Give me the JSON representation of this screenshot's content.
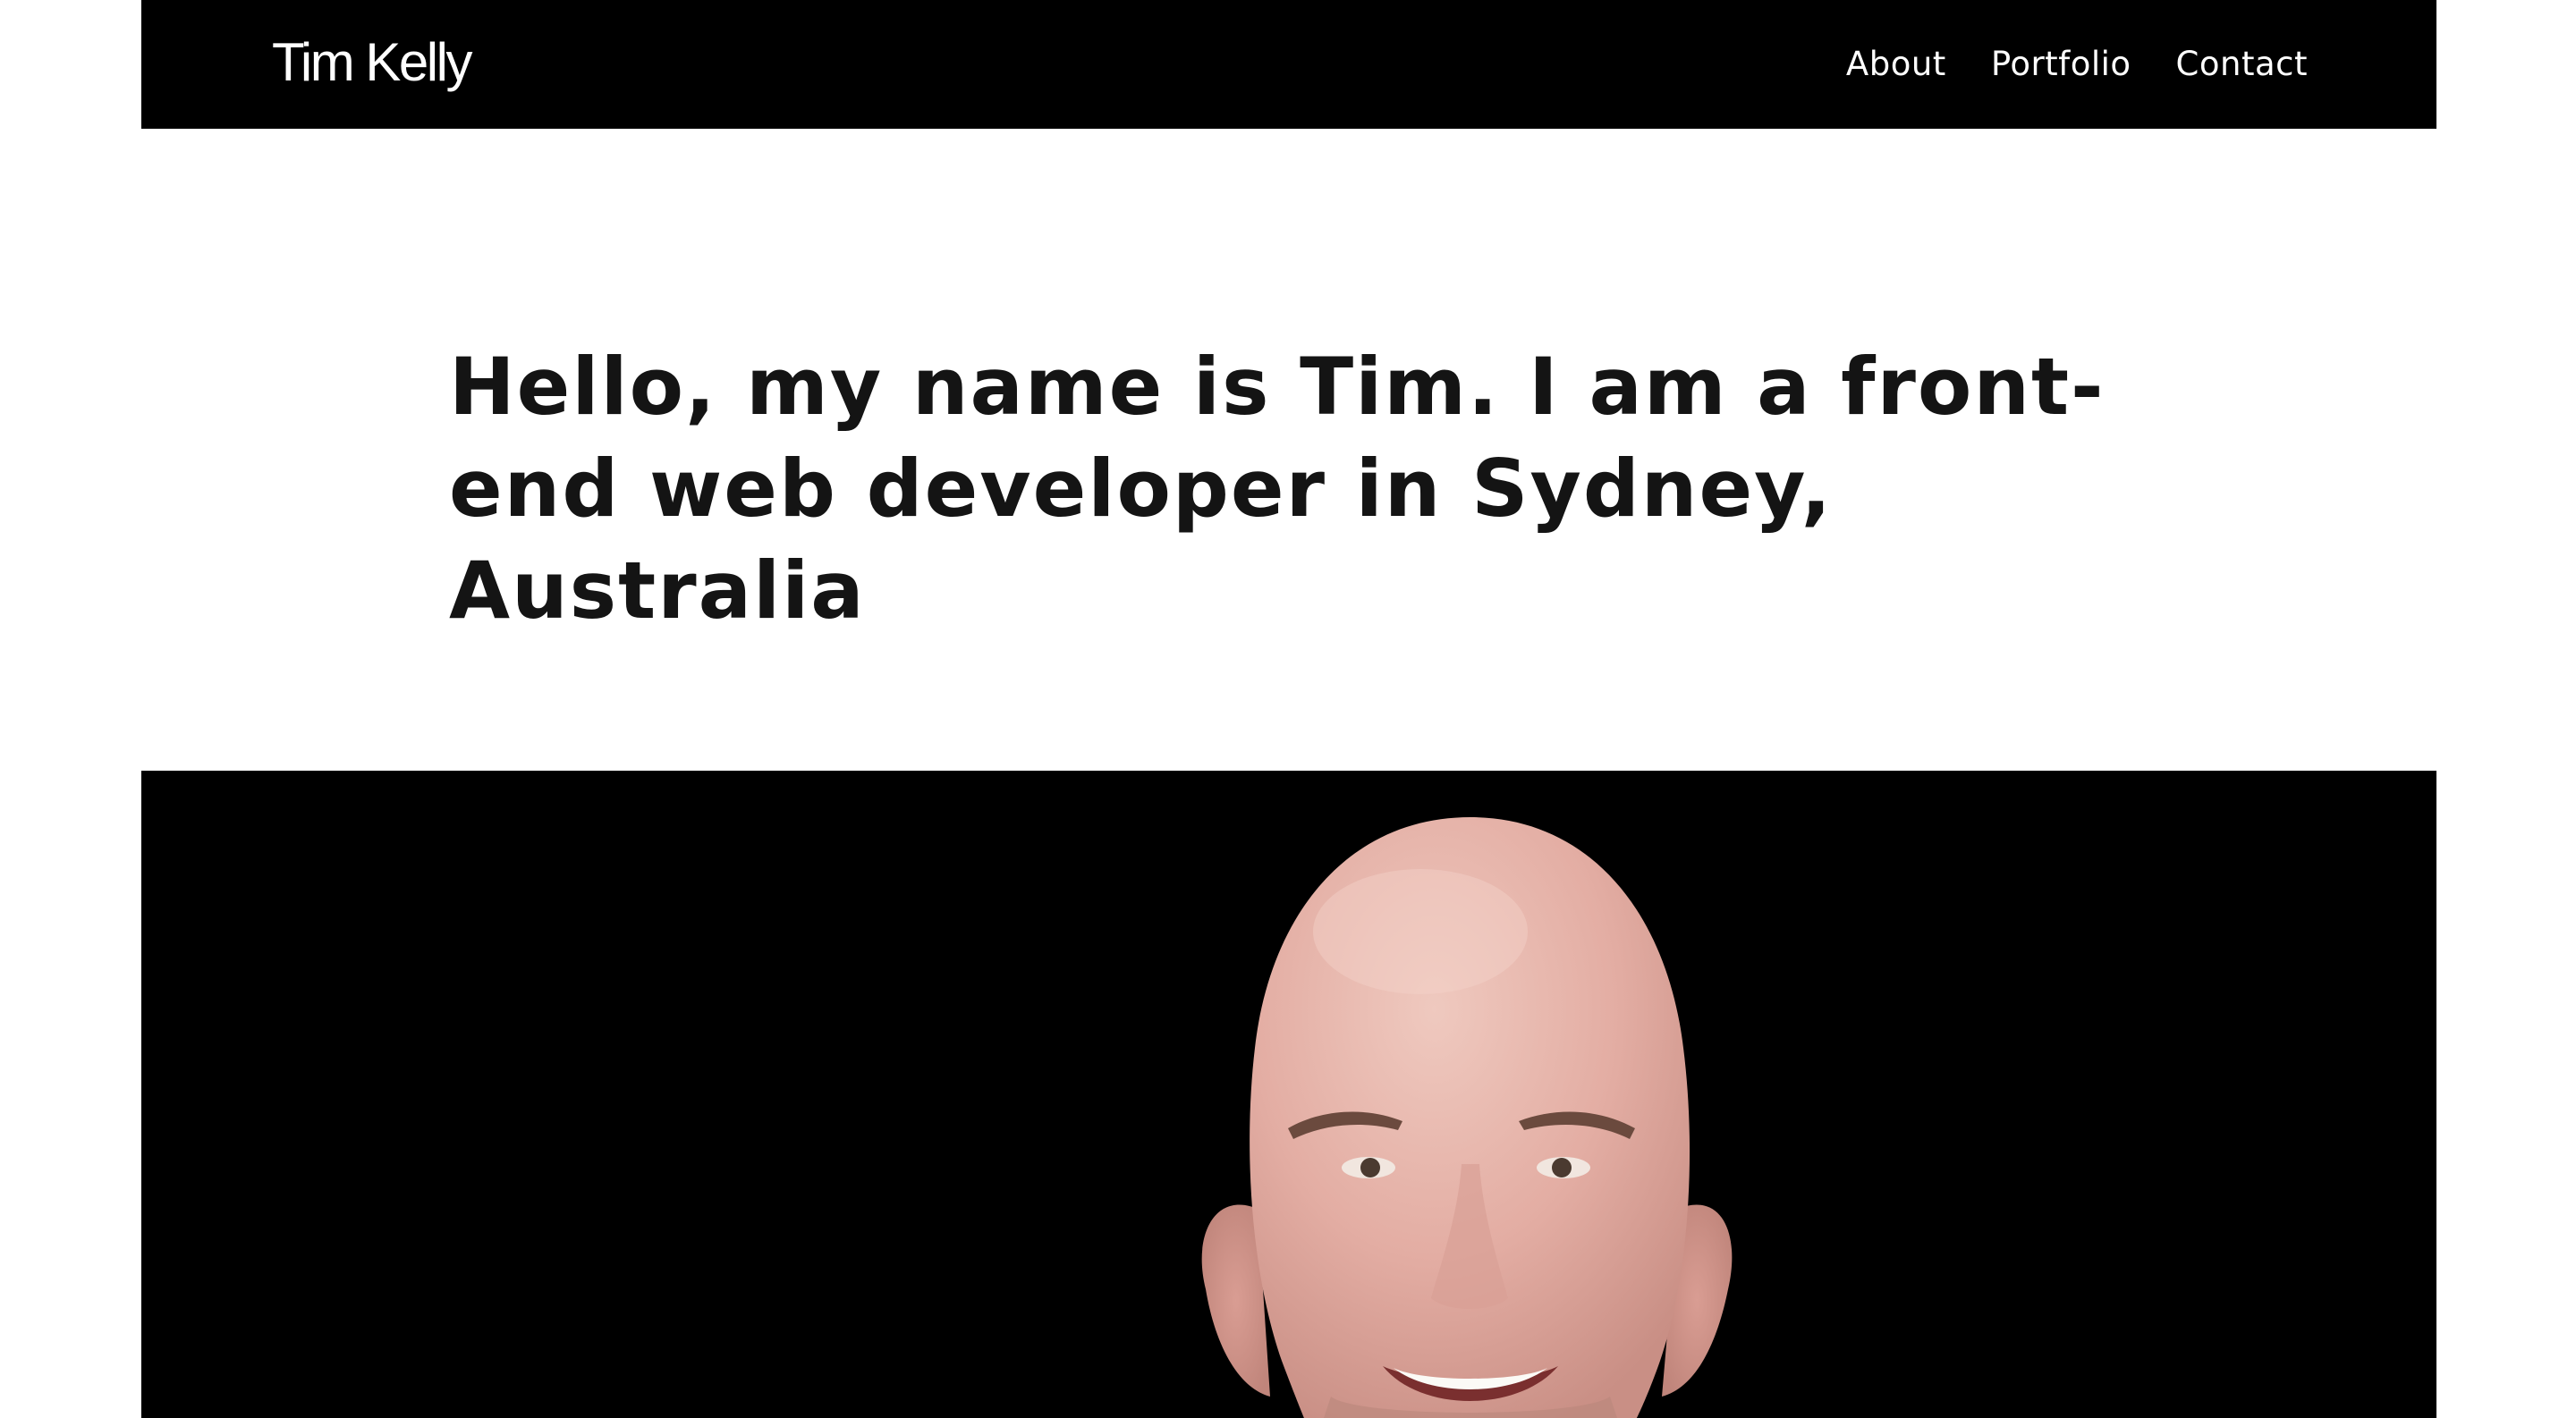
{
  "header": {
    "brand": "Tim Kelly",
    "nav": [
      {
        "label": "About"
      },
      {
        "label": "Portfolio"
      },
      {
        "label": "Contact"
      }
    ]
  },
  "hero": {
    "intro": "Hello, my name is Tim. I am a front-end web developer in Sydney, Australia"
  },
  "colors": {
    "navbar_bg": "#000000",
    "page_bg": "#ffffff",
    "heading_text": "#141414",
    "skin": "#e6b0a6"
  }
}
